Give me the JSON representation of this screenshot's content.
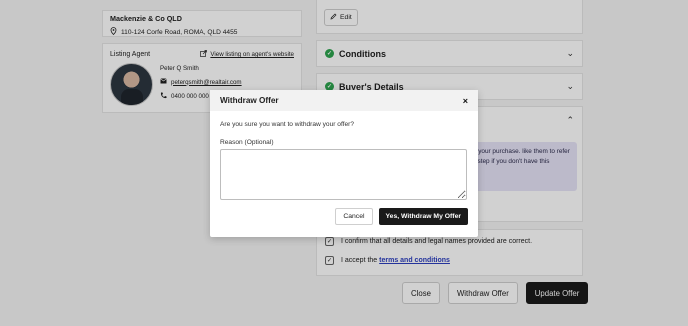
{
  "agency": {
    "name": "Mackenzie & Co QLD",
    "address": "110-124 Corfe Road, ROMA, QLD 4455"
  },
  "agent": {
    "section_title": "Listing Agent",
    "view_link": "View listing on agent's website",
    "name": "Peter Q Smith",
    "email": "peterqsmith@realtair.com",
    "phone": "0400 000 000"
  },
  "offer": {
    "edit_label": "Edit",
    "sections": [
      {
        "label": "Conditions"
      },
      {
        "label": "Buyer's Details"
      }
    ],
    "note_text": "you with your purchase. like them to refer you to a step if you don't have this",
    "confirm_text": "I confirm that all details and legal names provided are correct.",
    "accept_prefix": "I accept the",
    "accept_link": "terms and conditions",
    "buttons": {
      "close": "Close",
      "withdraw": "Withdraw Offer",
      "update": "Update Offer"
    }
  },
  "modal": {
    "title": "Withdraw Offer",
    "close_icon": "×",
    "question": "Are you sure you want to withdraw your offer?",
    "reason_label": "Reason (Optional)",
    "reason_value": "",
    "cancel_label": "Cancel",
    "confirm_label": "Yes, Withdraw My Offer"
  },
  "colors": {
    "success": "#2ea44f",
    "primary": "#1a1a1a",
    "link": "#2c3fbf",
    "note_bg": "#e6e3f7"
  }
}
